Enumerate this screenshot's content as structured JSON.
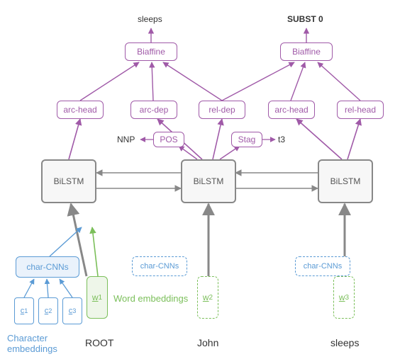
{
  "outputs": {
    "left": "sleeps",
    "right": "SUBST 0"
  },
  "biaffine": "Biaffine",
  "heads": {
    "arc_head_l": "arc-head",
    "arc_dep": "arc-dep",
    "rel_dep": "rel-dep",
    "arc_head_r": "arc-head",
    "rel_head": "rel-head"
  },
  "aux": {
    "nnp": "NNP",
    "pos": "POS",
    "stag": "Stag",
    "t3": "t3"
  },
  "bilstm": "BiLSTM",
  "charcnn": "char-CNNs",
  "char": {
    "c1": "c",
    "c2": "c",
    "c3": "c",
    "s1": "1",
    "s2": "2",
    "s3": "3"
  },
  "word": {
    "w": "w",
    "s1": "1",
    "s2": "2",
    "s3": "3"
  },
  "labels": {
    "word_emb": "Word embeddings",
    "char_emb": "Character\nembeddings",
    "root": "ROOT",
    "john": "John",
    "sleeps": "sleeps"
  }
}
